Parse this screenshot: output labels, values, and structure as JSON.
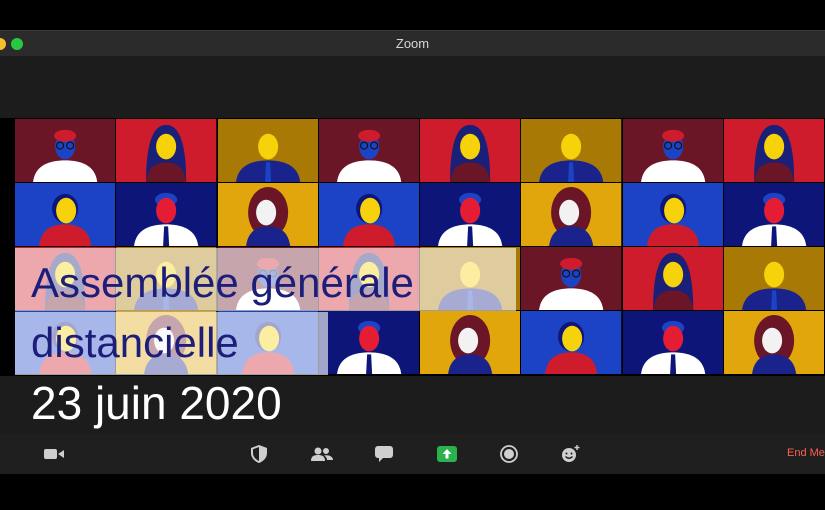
{
  "window": {
    "title": "Zoom"
  },
  "slide": {
    "headline_line1": "Assemblée générale",
    "headline_line2": "distancielle",
    "date": "23 juin 2020"
  },
  "toolbar": {
    "buttons": [
      {
        "name": "video-icon"
      },
      {
        "name": "security-icon"
      },
      {
        "name": "participants-icon"
      },
      {
        "name": "chat-icon"
      },
      {
        "name": "share-screen-icon"
      },
      {
        "name": "record-icon"
      },
      {
        "name": "reactions-icon"
      }
    ],
    "end_label": "End Me"
  },
  "colors": {
    "maroon": "#6b1627",
    "red": "#cf1c2c",
    "mustard": "#a87a05",
    "gold": "#e0a60c",
    "blue": "#1c43c6",
    "navy": "#0d1678",
    "skin_yellow": "#f5d20a",
    "skin_red": "#e41d35",
    "skin_white": "#f2f2f2",
    "headline": "#1d1d7a",
    "end_red": "#ff5f57",
    "share_green": "#2bb24c"
  },
  "gallery": {
    "tiles": [
      {
        "bg": "#6b1627",
        "face": "#1c43c6",
        "type": "man-glasses",
        "shirt": "#ffffff",
        "tie": "none"
      },
      {
        "bg": "#cf1c2c",
        "face": "#f5d20a",
        "type": "woman-long",
        "hair": "#1a1f78",
        "shirt": "#6b1627"
      },
      {
        "bg": "#a87a05",
        "face": "#f5d20a",
        "type": "man-suit",
        "shirt": "#1a238c",
        "tie": "#1c43c6"
      },
      {
        "bg": "#6b1627",
        "face": "#1c43c6",
        "type": "man-glasses",
        "shirt": "#ffffff",
        "tie": "none"
      },
      {
        "bg": "#cf1c2c",
        "face": "#f5d20a",
        "type": "woman-long",
        "hair": "#1a1f78",
        "shirt": "#6b1627"
      },
      {
        "bg": "#a87a05",
        "face": "#f5d20a",
        "type": "man-suit",
        "shirt": "#1a238c",
        "tie": "#1c43c6"
      },
      {
        "bg": "#6b1627",
        "face": "#1c43c6",
        "type": "man-glasses",
        "shirt": "#ffffff",
        "tie": "none"
      },
      {
        "bg": "#cf1c2c",
        "face": "#f5d20a",
        "type": "woman-long",
        "hair": "#1a1f78",
        "shirt": "#6b1627"
      },
      {
        "bg": "#1c43c6",
        "face": "#f5d20a",
        "type": "woman-short",
        "hair": "#0d1678",
        "shirt": "#cf1c2c"
      },
      {
        "bg": "#0d1678",
        "face": "#e41d35",
        "type": "man-tie",
        "hair": "#1c43c6",
        "shirt": "#ffffff",
        "tie": "#0d1678"
      },
      {
        "bg": "#e0a60c",
        "face": "#f2f2f2",
        "type": "woman-curly",
        "hair": "#6b1627",
        "shirt": "#1a238c"
      },
      {
        "bg": "#1c43c6",
        "face": "#f5d20a",
        "type": "woman-short",
        "hair": "#0d1678",
        "shirt": "#cf1c2c"
      },
      {
        "bg": "#0d1678",
        "face": "#e41d35",
        "type": "man-tie",
        "hair": "#1c43c6",
        "shirt": "#ffffff",
        "tie": "#0d1678"
      },
      {
        "bg": "#e0a60c",
        "face": "#f2f2f2",
        "type": "woman-curly",
        "hair": "#6b1627",
        "shirt": "#1a238c"
      },
      {
        "bg": "#1c43c6",
        "face": "#f5d20a",
        "type": "woman-short",
        "hair": "#0d1678",
        "shirt": "#cf1c2c"
      },
      {
        "bg": "#0d1678",
        "face": "#e41d35",
        "type": "man-tie",
        "hair": "#1c43c6",
        "shirt": "#ffffff",
        "tie": "#0d1678"
      },
      {
        "bg": "#cf1c2c",
        "face": "#f5d20a",
        "type": "woman-long",
        "hair": "#1a1f78",
        "shirt": "#6b1627"
      },
      {
        "bg": "#a87a05",
        "face": "#f5d20a",
        "type": "man-suit",
        "shirt": "#1a238c",
        "tie": "#1c43c6"
      },
      {
        "bg": "#6b1627",
        "face": "#1c43c6",
        "type": "man-glasses",
        "shirt": "#ffffff",
        "tie": "none"
      },
      {
        "bg": "#cf1c2c",
        "face": "#f5d20a",
        "type": "woman-long",
        "hair": "#1a1f78",
        "shirt": "#6b1627"
      },
      {
        "bg": "#a87a05",
        "face": "#f5d20a",
        "type": "man-suit",
        "shirt": "#1a238c",
        "tie": "#1c43c6"
      },
      {
        "bg": "#6b1627",
        "face": "#1c43c6",
        "type": "man-glasses",
        "shirt": "#ffffff",
        "tie": "none"
      },
      {
        "bg": "#cf1c2c",
        "face": "#f5d20a",
        "type": "woman-long",
        "hair": "#1a1f78",
        "shirt": "#6b1627"
      },
      {
        "bg": "#a87a05",
        "face": "#f5d20a",
        "type": "man-suit",
        "shirt": "#1a238c",
        "tie": "#1c43c6"
      },
      {
        "bg": "#1c43c6",
        "face": "#f5d20a",
        "type": "woman-short",
        "hair": "#0d1678",
        "shirt": "#cf1c2c"
      },
      {
        "bg": "#e0a60c",
        "face": "#f2f2f2",
        "type": "woman-curly",
        "hair": "#6b1627",
        "shirt": "#1a238c"
      },
      {
        "bg": "#1c43c6",
        "face": "#f5d20a",
        "type": "woman-short",
        "hair": "#0d1678",
        "shirt": "#cf1c2c"
      },
      {
        "bg": "#0d1678",
        "face": "#e41d35",
        "type": "man-tie",
        "hair": "#1c43c6",
        "shirt": "#ffffff",
        "tie": "#0d1678"
      },
      {
        "bg": "#e0a60c",
        "face": "#f2f2f2",
        "type": "woman-curly",
        "hair": "#6b1627",
        "shirt": "#1a238c"
      },
      {
        "bg": "#1c43c6",
        "face": "#f5d20a",
        "type": "woman-short",
        "hair": "#0d1678",
        "shirt": "#cf1c2c"
      },
      {
        "bg": "#0d1678",
        "face": "#e41d35",
        "type": "man-tie",
        "hair": "#1c43c6",
        "shirt": "#ffffff",
        "tie": "#0d1678"
      },
      {
        "bg": "#e0a60c",
        "face": "#f2f2f2",
        "type": "woman-curly",
        "hair": "#6b1627",
        "shirt": "#1a238c"
      }
    ]
  }
}
